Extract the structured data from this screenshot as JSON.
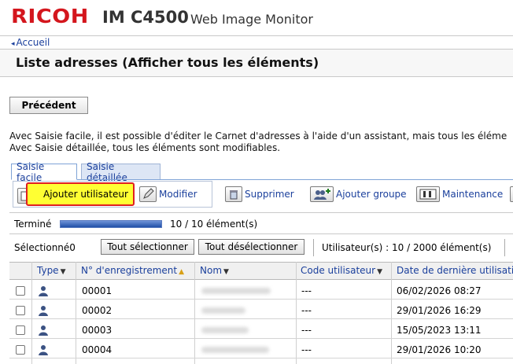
{
  "header": {
    "brand": "RICOH",
    "model": "IM C4500",
    "product": "Web Image Monitor"
  },
  "breadcrumb": {
    "label": "Accueil"
  },
  "page": {
    "title": "Liste adresses (Afficher tous les éléments)"
  },
  "back_button": "Précédent",
  "info": {
    "line1": "Avec Saisie facile, il est possible d'éditer le Carnet d'adresses à l'aide d'un assistant, mais tous les éléme",
    "line2": "Avec Saisie détaillée, tous les éléments sont modifiables."
  },
  "tabs": [
    {
      "label": "Saisie facile",
      "active": true
    },
    {
      "label": "Saisie détaillée",
      "active": false
    }
  ],
  "toolbar": {
    "add_user": "Ajouter utilisateur",
    "modify": "Modifier",
    "delete": "Supprimer",
    "add_group": "Ajouter groupe",
    "maintenance": "Maintenance"
  },
  "progress": {
    "label": "Terminé",
    "fraction": 1.0,
    "text": "10 / 10 élément(s)"
  },
  "selection": {
    "label": "Sélectionné0",
    "select_all": "Tout sélectionner",
    "deselect_all": "Tout désélectionner",
    "user_count": "Utilisateur(s) : 10 / 2000 élément(s)"
  },
  "table": {
    "columns": [
      "Type",
      "N° d'enregistrement",
      "Nom",
      "Code utilisateur",
      "Date de dernière utilisati"
    ],
    "rows": [
      {
        "reg": "00001",
        "code": "---",
        "date": "06/02/2026 08:27"
      },
      {
        "reg": "00002",
        "code": "---",
        "date": "29/01/2026 16:29"
      },
      {
        "reg": "00003",
        "code": "---",
        "date": "15/05/2023 13:11"
      },
      {
        "reg": "00004",
        "code": "---",
        "date": "29/01/2026 10:20"
      }
    ]
  },
  "colors": {
    "brand_red": "#d4161d",
    "link_blue": "#1a3f9c",
    "highlight_yellow": "#ffff33",
    "highlight_border": "#e02020"
  }
}
